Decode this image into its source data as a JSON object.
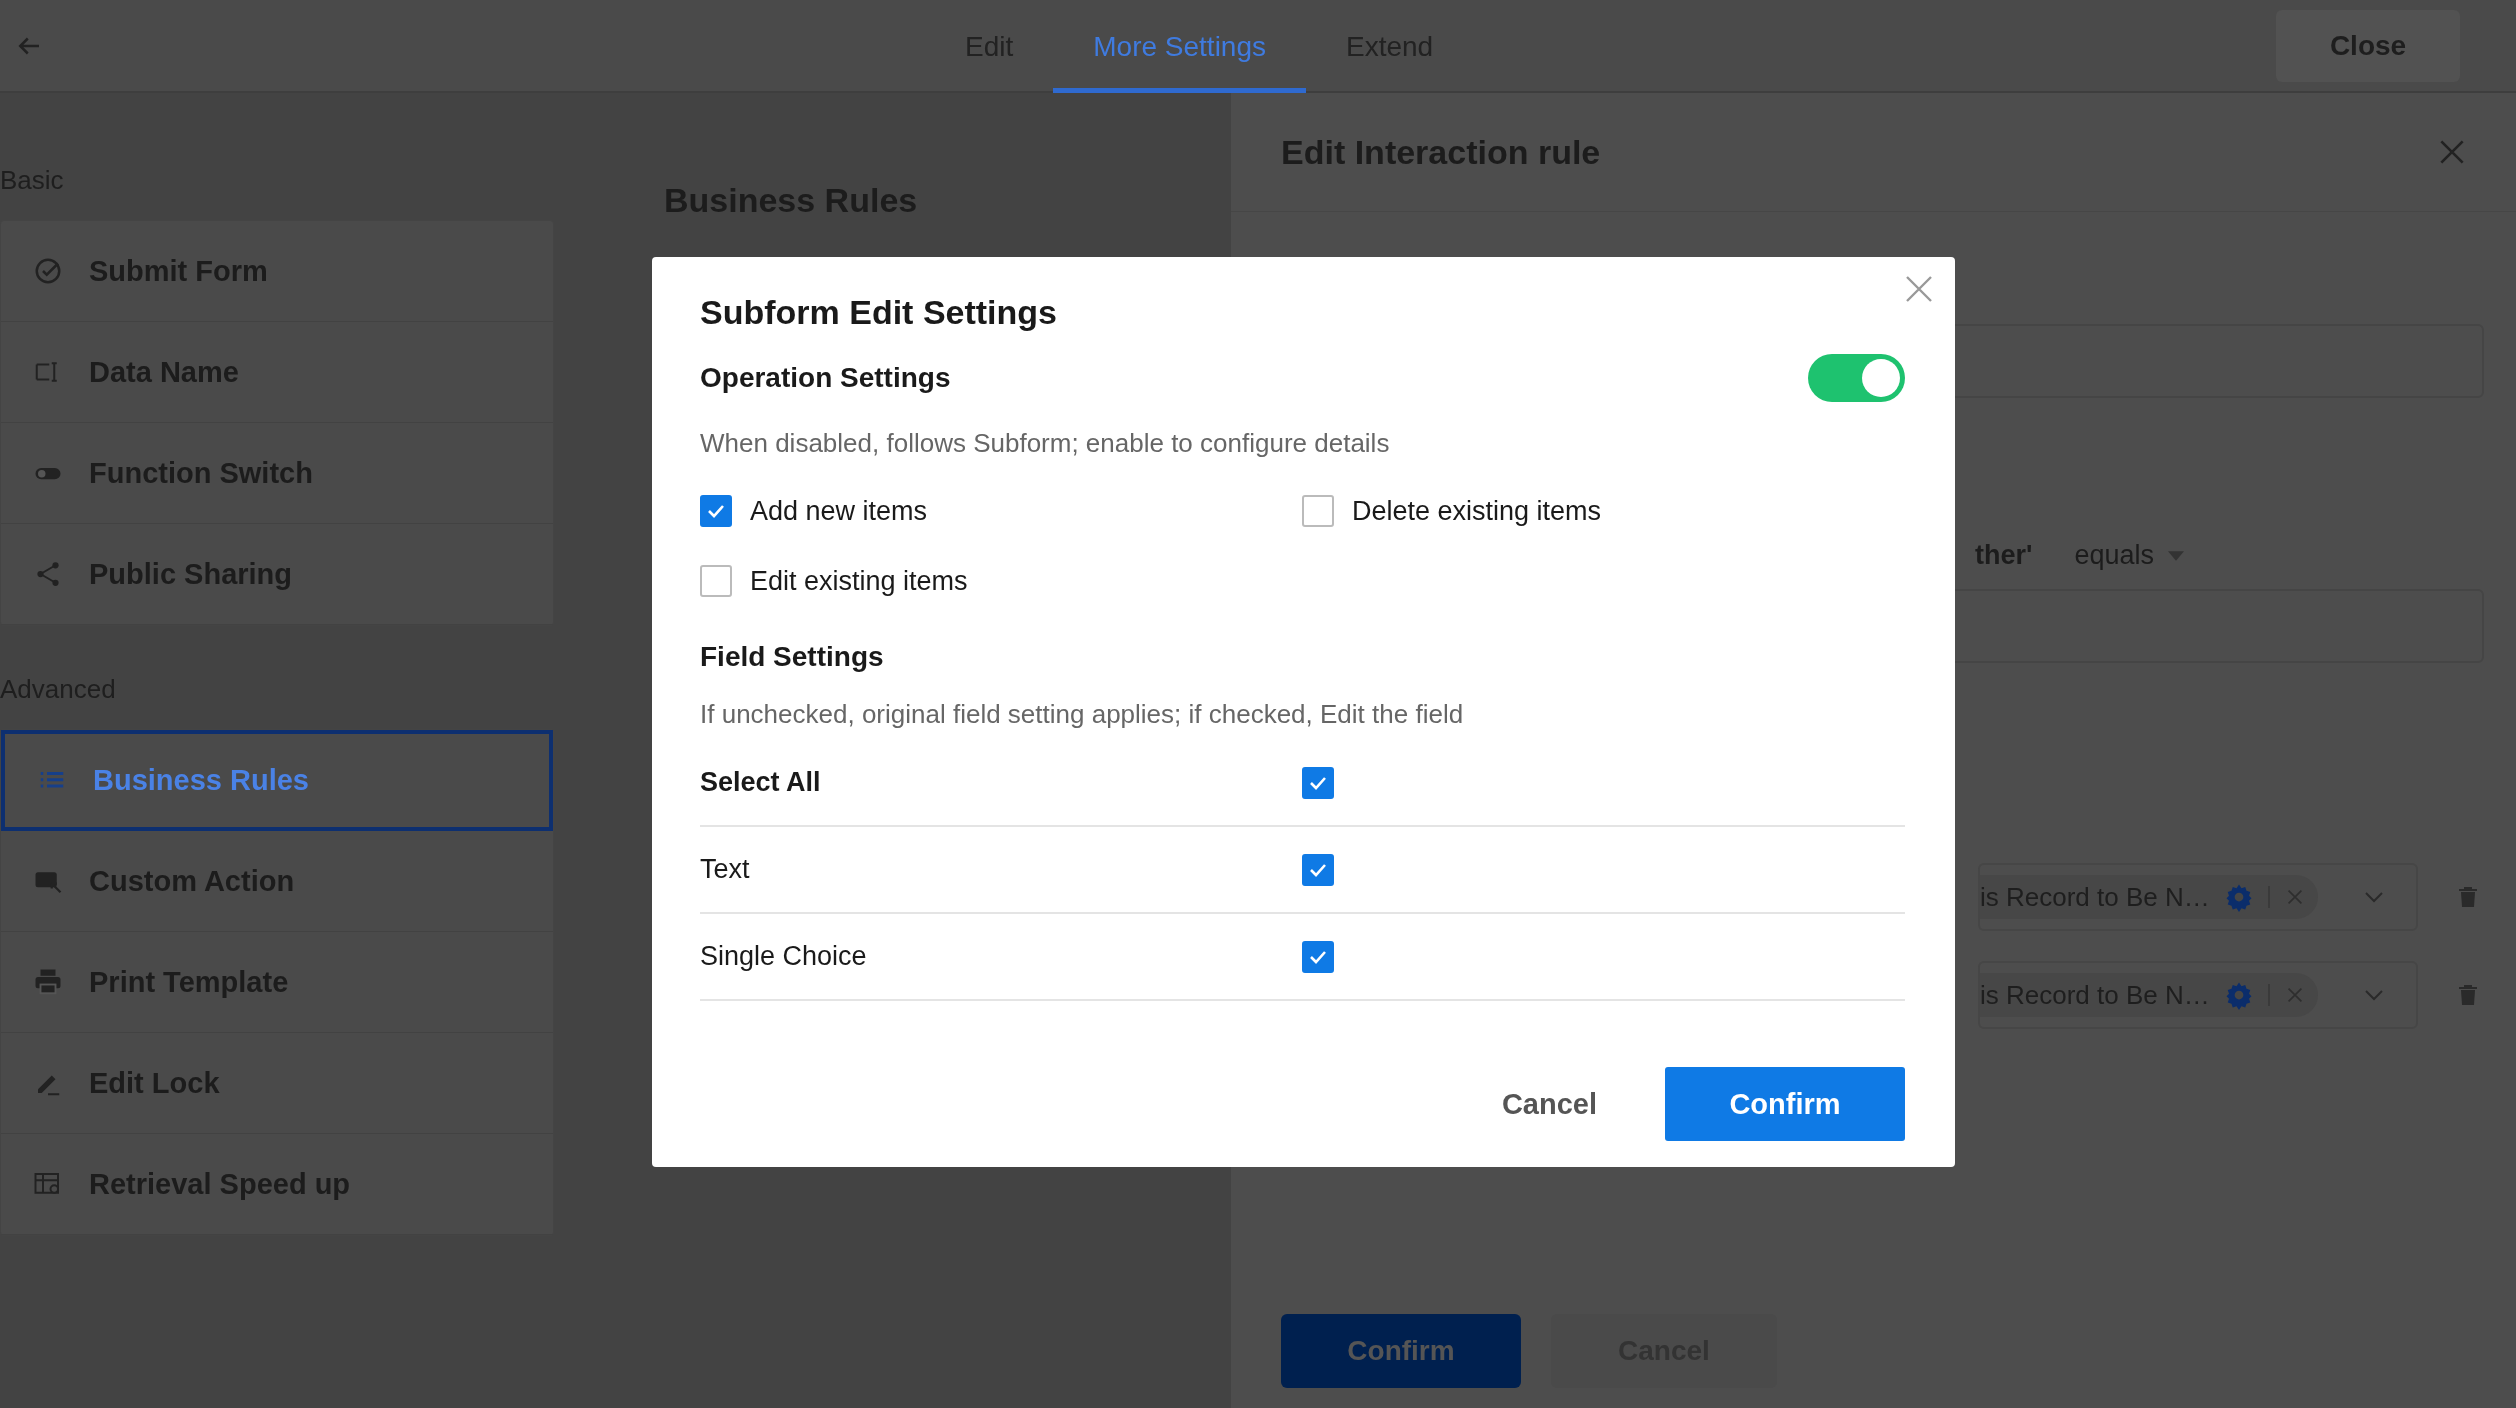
{
  "top_bar": {
    "tabs": [
      {
        "label": "Edit",
        "selected": false
      },
      {
        "label": "More Settings",
        "selected": true
      },
      {
        "label": "Extend",
        "selected": false
      }
    ],
    "close_button": "Close"
  },
  "sidebar": {
    "sections": [
      {
        "title": "Basic",
        "items": [
          {
            "label": "Submit Form",
            "selected": false
          },
          {
            "label": "Data Name",
            "selected": false
          },
          {
            "label": "Function Switch",
            "selected": false
          },
          {
            "label": "Public Sharing",
            "selected": false
          }
        ]
      },
      {
        "title": "Advanced",
        "items": [
          {
            "label": "Business Rules",
            "selected": true
          },
          {
            "label": "Custom Action",
            "selected": false
          },
          {
            "label": "Print Template",
            "selected": false
          },
          {
            "label": "Edit Lock",
            "selected": false
          },
          {
            "label": "Retrieval Speed up",
            "selected": false
          }
        ]
      }
    ]
  },
  "main": {
    "heading": "Business Rules"
  },
  "rule_panel": {
    "title": "Edit Interaction rule",
    "condition_field": "ther'",
    "operator": "equals",
    "actions": [
      {
        "value": "is Record to Be N…"
      },
      {
        "value": "is Record to Be N…"
      }
    ],
    "confirm_button": "Confirm",
    "cancel_button": "Cancel"
  },
  "dialog": {
    "title": "Subform Edit Settings",
    "operation_settings": {
      "label": "Operation Settings",
      "on": true,
      "description": "When disabled, follows Subform; enable to configure details",
      "options": [
        {
          "label": "Add new items",
          "checked": true
        },
        {
          "label": "Delete existing items",
          "checked": false
        },
        {
          "label": "Edit existing items",
          "checked": false
        }
      ]
    },
    "field_settings": {
      "label": "Field Settings",
      "description": "If unchecked, original field setting applies; if checked, Edit the field",
      "rows": [
        {
          "label": "Select All",
          "checked": true,
          "kind": "header"
        },
        {
          "label": "Text",
          "checked": true,
          "kind": "field"
        },
        {
          "label": "Single Choice",
          "checked": true,
          "kind": "field"
        }
      ]
    },
    "cancel_button": "Cancel",
    "confirm_button": "Confirm"
  }
}
